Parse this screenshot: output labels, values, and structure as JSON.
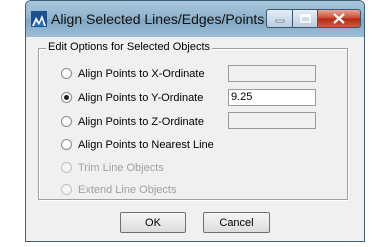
{
  "window": {
    "title": "Align Selected Lines/Edges/Points",
    "app_icon": "sap-logo-icon",
    "controls": {
      "minimize": "minimize-icon",
      "maximize": "maximize-icon",
      "close": "close-icon"
    }
  },
  "group": {
    "label": "Edit Options for Selected Objects"
  },
  "options": [
    {
      "label": "Align Points to X-Ordinate",
      "checked": false,
      "enabled": true,
      "field_value": "",
      "field_enabled": false
    },
    {
      "label": "Align Points to Y-Ordinate",
      "checked": true,
      "enabled": true,
      "field_value": "9.25",
      "field_enabled": true
    },
    {
      "label": "Align Points to Z-Ordinate",
      "checked": false,
      "enabled": true,
      "field_value": "",
      "field_enabled": false
    },
    {
      "label": "Align Points to Nearest Line",
      "checked": false,
      "enabled": true
    },
    {
      "label": "Trim Line Objects",
      "checked": false,
      "enabled": false
    },
    {
      "label": "Extend Line Objects",
      "checked": false,
      "enabled": false
    }
  ],
  "buttons": {
    "ok": "OK",
    "cancel": "Cancel"
  },
  "colors": {
    "titlebar": "#8fb2cc",
    "close_button": "#c9452c",
    "disabled_text": "#a0a0a0"
  }
}
